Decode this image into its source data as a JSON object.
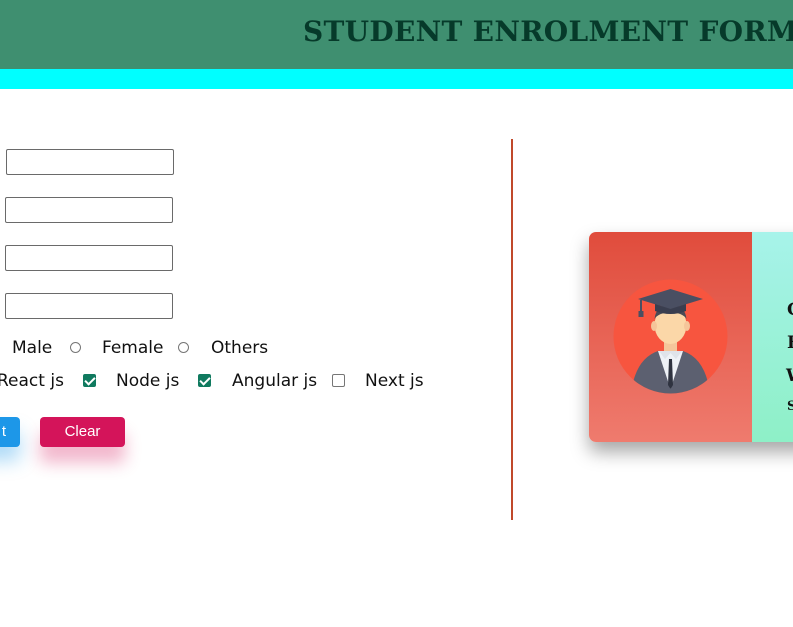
{
  "header": {
    "title": "STUDENT ENROLMENT FORM"
  },
  "form": {
    "inputs": [
      {
        "value": ""
      },
      {
        "value": ""
      },
      {
        "value": ""
      },
      {
        "value": ""
      }
    ],
    "gender": {
      "selected": "",
      "options": [
        {
          "label": "Male",
          "checked": false
        },
        {
          "label": "Female",
          "checked": false
        },
        {
          "label": "Others",
          "checked": false
        }
      ]
    },
    "skills": [
      {
        "label": "React js"
      },
      {
        "label": "Node js",
        "checked": true
      },
      {
        "label": "Angular js",
        "checked": true
      },
      {
        "label": "Next js",
        "checked": false
      }
    ],
    "buttons": {
      "submit_label": "t",
      "clear_label": "Clear"
    }
  },
  "card": {
    "icon": "graduate-avatar-icon",
    "lines": [
      "C",
      "E",
      "W",
      "S"
    ]
  },
  "colors": {
    "header_bg": "#3f8f70",
    "header_text": "#063a2a",
    "cyan_bar": "#00ffff",
    "divider": "#c0492b",
    "checkbox_checked": "#107a5f",
    "submit_button": "#1d97e8",
    "clear_button": "#d4145a",
    "card_left_top": "#e04c3c",
    "card_right": "#a7f3ea"
  }
}
